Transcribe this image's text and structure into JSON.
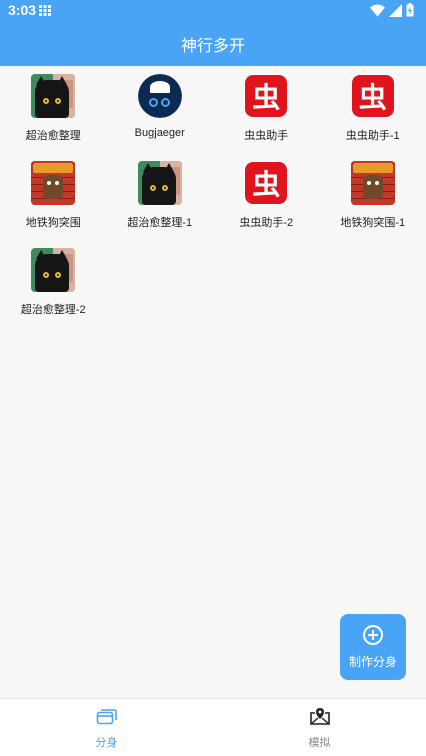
{
  "status_bar": {
    "time": "3:03",
    "icons": [
      "grid-icon",
      "wifi-icon",
      "signal-icon",
      "battery-charging-icon"
    ]
  },
  "app_bar": {
    "title": "神行多开"
  },
  "apps": [
    {
      "label": "超治愈整理",
      "icon": "black-cat-app-icon"
    },
    {
      "label": "Bugjaeger",
      "icon": "bugjaeger-app-icon"
    },
    {
      "label": "虫虫助手",
      "icon": "chongchong-app-icon"
    },
    {
      "label": "虫虫助手-1",
      "icon": "chongchong-app-icon"
    },
    {
      "label": "地铁狗突围",
      "icon": "subway-dog-app-icon"
    },
    {
      "label": "超治愈整理-1",
      "icon": "black-cat-app-icon"
    },
    {
      "label": "虫虫助手-2",
      "icon": "chongchong-app-icon"
    },
    {
      "label": "地铁狗突围-1",
      "icon": "subway-dog-app-icon"
    },
    {
      "label": "超治愈整理-2",
      "icon": "black-cat-app-icon"
    }
  ],
  "chong_glyph": "虫",
  "fab": {
    "label": "制作分身",
    "icon": "plus-circle-icon"
  },
  "bottom_nav": {
    "items": [
      {
        "label": "分身",
        "icon": "cards-icon",
        "active": true
      },
      {
        "label": "模拟",
        "icon": "location-download-icon",
        "active": false
      }
    ]
  },
  "colors": {
    "primary": "#4aa4f5",
    "background": "#f7f7f7",
    "chong_red": "#e0141d"
  }
}
